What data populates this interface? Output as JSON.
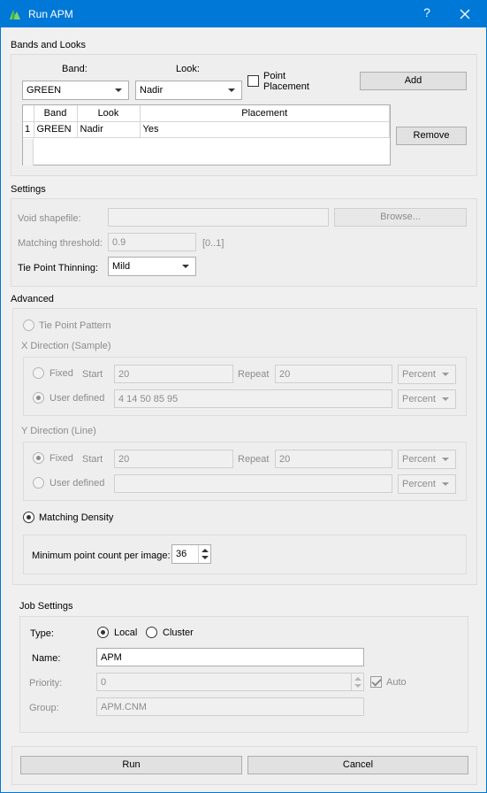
{
  "window": {
    "title": "Run APM",
    "help_label": "?"
  },
  "bands_looks": {
    "section_title": "Bands and Looks",
    "band_label": "Band:",
    "look_label": "Look:",
    "band_value": "GREEN",
    "look_value": "Nadir",
    "point_placement_label": "Point Placement",
    "point_placement_checked": false,
    "add_label": "Add",
    "remove_label": "Remove",
    "table": {
      "columns": [
        "Band",
        "Look",
        "Placement"
      ],
      "rows": [
        {
          "index": "1",
          "band": "GREEN",
          "look": "Nadir",
          "placement": "Yes"
        }
      ]
    }
  },
  "settings": {
    "section_title": "Settings",
    "void_label": "Void shapefile:",
    "void_value": "",
    "browse_label": "Browse...",
    "threshold_label": "Matching threshold:",
    "threshold_value": "0.9",
    "threshold_range": "[0..1]",
    "thinning_label": "Tie Point Thinning:",
    "thinning_value": "Mild"
  },
  "advanced": {
    "section_title": "Advanced",
    "tie_point_pattern_label": "Tie Point Pattern",
    "x_direction": {
      "title": "X Direction (Sample)",
      "fixed_label": "Fixed",
      "start_label": "Start",
      "start_value": "20",
      "repeat_label": "Repeat",
      "repeat_value": "20",
      "fixed_unit": "Percent",
      "user_defined_label": "User defined",
      "user_defined_value": "4 14 50 85 95",
      "user_unit": "Percent",
      "selected": "user_defined"
    },
    "y_direction": {
      "title": "Y Direction (Line)",
      "fixed_label": "Fixed",
      "start_label": "Start",
      "start_value": "20",
      "repeat_label": "Repeat",
      "repeat_value": "20",
      "fixed_unit": "Percent",
      "user_defined_label": "User defined",
      "user_defined_value": "",
      "user_unit": "Percent",
      "selected": "fixed"
    },
    "matching_density_label": "Matching Density",
    "min_point_label": "Minimum point count per image:",
    "min_point_value": "36"
  },
  "job": {
    "section_title": "Job Settings",
    "type_label": "Type:",
    "local_label": "Local",
    "cluster_label": "Cluster",
    "type_selected": "local",
    "name_label": "Name:",
    "name_value": "APM",
    "priority_label": "Priority:",
    "priority_value": "0",
    "auto_label": "Auto",
    "auto_checked": true,
    "group_label": "Group:",
    "group_value": "APM.CNM"
  },
  "footer": {
    "run_label": "Run",
    "cancel_label": "Cancel"
  },
  "colors": {
    "titlebar": "#0078d7",
    "background": "#f0f0f0"
  }
}
